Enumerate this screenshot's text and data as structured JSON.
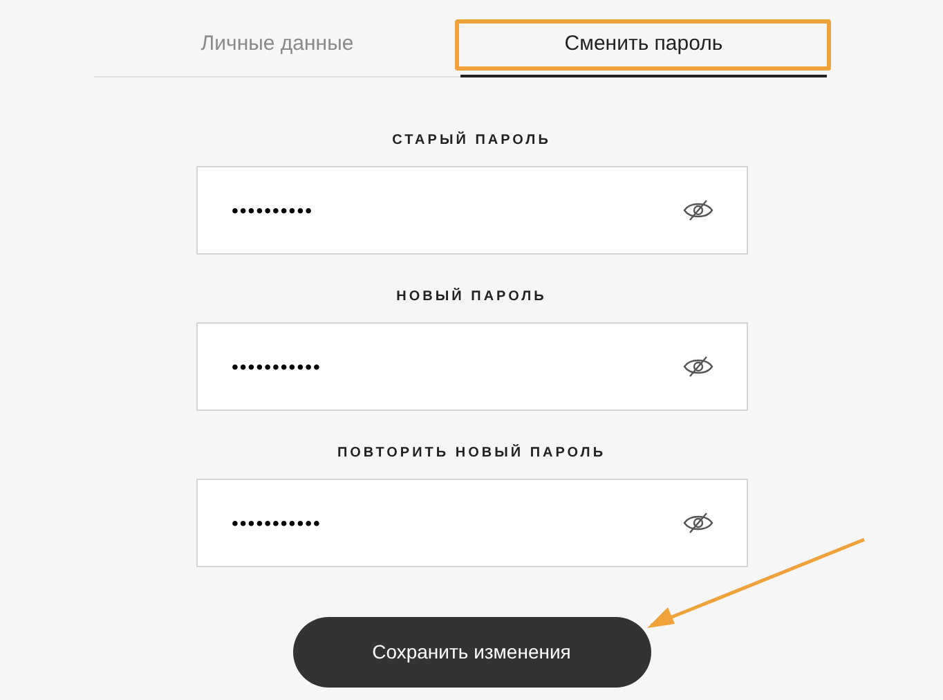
{
  "tabs": [
    {
      "label": "Личные данные",
      "selected": false
    },
    {
      "label": "Сменить пароль",
      "selected": true
    }
  ],
  "fields": [
    {
      "label": "СТАРЫЙ ПАРОЛЬ",
      "value": "••••••••••",
      "reveal": false
    },
    {
      "label": "НОВЫЙ ПАРОЛЬ",
      "value": "•••••••••••",
      "reveal": false
    },
    {
      "label": "ПОВТОРИТЬ НОВЫЙ ПАРОЛЬ",
      "value": "•••••••••••",
      "reveal": false
    }
  ],
  "save_button": "Сохранить изменения",
  "highlight_frame": {
    "color": "#f0a23a"
  },
  "arrow": {
    "color": "#f0a23a"
  }
}
